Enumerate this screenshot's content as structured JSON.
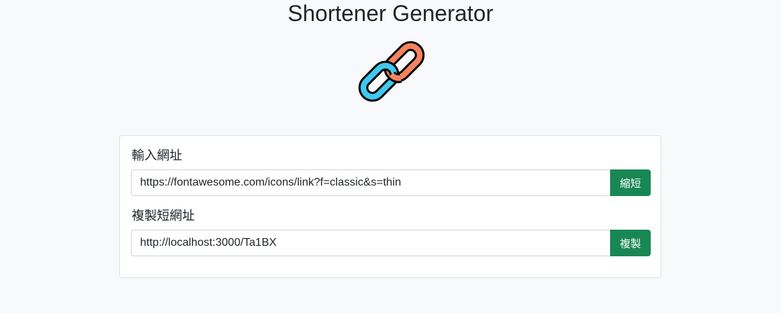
{
  "header": {
    "title": "Shortener Generator",
    "logo_icon": "link-icon"
  },
  "form": {
    "url_label": "輸入網址",
    "url_value": "https://fontawesome.com/icons/link?f=classic&s=thin",
    "shorten_button": "縮短",
    "short_label": "複製短網址",
    "short_value": "http://localhost:3000/Ta1BX",
    "copy_button": "複製"
  },
  "colors": {
    "background": "#f8f9fa",
    "button": "#198754",
    "link_orange": "#f4845f",
    "link_blue": "#3fc8f1"
  }
}
